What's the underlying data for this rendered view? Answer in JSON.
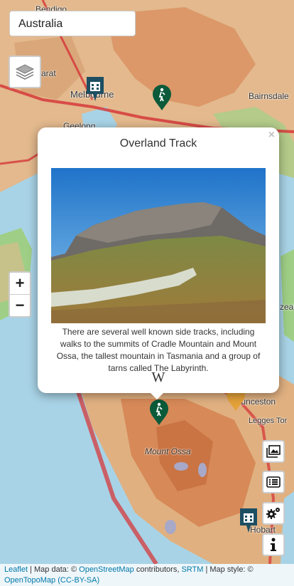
{
  "search": {
    "value": "Australia"
  },
  "map_labels": {
    "bendigo": "Bendigo",
    "ararat": "arat",
    "melbourne": "Melbourne",
    "bairnsdale": "Bairnsdale",
    "geelong": "Geelong",
    "launceston": "Launceston",
    "legges_tor": "Legges Tor",
    "mount_ossa": "Mount Ossa",
    "hobart": "Hobart",
    "zeale": "zeale"
  },
  "zoom": {
    "in_label": "+",
    "out_label": "−"
  },
  "popup": {
    "close_label": "×",
    "title": "Overland Track",
    "description": "There are several well known side tracks, including walks to the summits of Cradle Mountain and Mount Ossa, the tallest mountain in Tasmania and a group of tarns called The Labyrinth.",
    "wiki_label": "W"
  },
  "icons": {
    "layers": "layers-icon",
    "gallery": "image-gallery-icon",
    "list": "list-icon",
    "settings": "gears-icon",
    "info": "info-icon",
    "hiking": "hiker-marker-icon",
    "city": "city-marker-icon"
  },
  "attribution": {
    "leaflet": "Leaflet",
    "sep1": " | Map data: © ",
    "osm": "OpenStreetMap",
    "contributors": " contributors, ",
    "srtm": "SRTM",
    "style": " | Map style: © ",
    "opentopo": "OpenTopoMap",
    "license": "(CC-BY-SA)"
  },
  "colors": {
    "water": "#a8d3e6",
    "land_low": "#e8c9a0",
    "land_high": "#d98a5a",
    "forest": "#7fbf6a",
    "road": "#d6383b",
    "marker_green": "#0b5a3a",
    "marker_teal": "#1d4f63",
    "marker_orange": "#e5a23a"
  }
}
